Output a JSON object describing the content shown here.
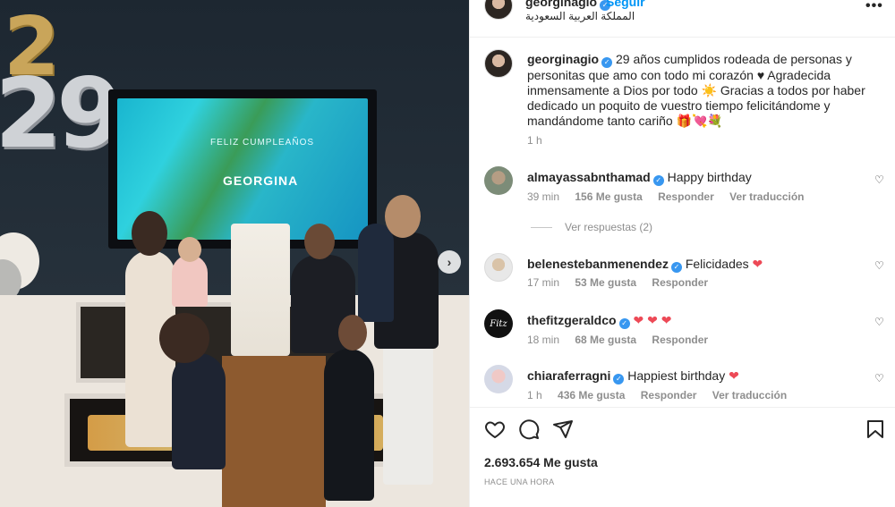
{
  "post": {
    "header": {
      "username": "georginagio",
      "follow_label": "Seguir",
      "location": "المملكة العربية السعودية",
      "more_label": "•••"
    },
    "photo": {
      "tv_line1": "FELIZ CUMPLEAÑOS",
      "tv_line2": "GEORGINA",
      "balloon_top": "2",
      "balloon_number": "29",
      "next_label": "›"
    },
    "caption": {
      "username": "georginagio",
      "text": "29 años cumplidos rodeada de personas y personitas que amo con todo mi corazón ♥ Agradecida inmensamente a Dios por todo ☀️ Gracias a todos por haber dedicado un poquito de vuestro tiempo felicitándome y mandándome tanto cariño 🎁💘💐",
      "time": "1 h"
    },
    "comments": [
      {
        "username": "almayassabnthamad",
        "text": "Happy birthday",
        "time": "39 min",
        "likes": "156 Me gusta",
        "reply": "Responder",
        "translate": "Ver traducción"
      },
      {
        "username": "belenesteban​menendez",
        "text": "Felicidades",
        "heart": "❤",
        "time": "17 min",
        "likes": "53 Me gusta",
        "reply": "Responder"
      },
      {
        "username": "thefitzgeraldco",
        "text": "",
        "heart": "❤ ❤ ❤",
        "time": "18 min",
        "likes": "68 Me gusta",
        "reply": "Responder",
        "avatar_text": "Fitz"
      },
      {
        "username": "chiaraferragni",
        "text": "Happiest birthday",
        "heart": "❤",
        "time": "1 h",
        "likes": "436 Me gusta",
        "reply": "Responder",
        "translate": "Ver traducción"
      }
    ],
    "view_replies": "Ver respuestas (2)",
    "like_count": "2.693.654 Me gusta",
    "time_ago": "HACE UNA HORA",
    "verified_mark": "✓",
    "small_heart": "♡"
  },
  "colors": {
    "link_blue": "#0095f6",
    "verified_blue": "#3897f0",
    "heart_red": "#ed4956",
    "muted_text": "#8e8e8e"
  },
  "icons": [
    "heart-outline-icon",
    "comment-icon",
    "share-icon",
    "bookmark-icon",
    "verified-badge-icon",
    "more-options-icon",
    "chevron-right-icon"
  ]
}
